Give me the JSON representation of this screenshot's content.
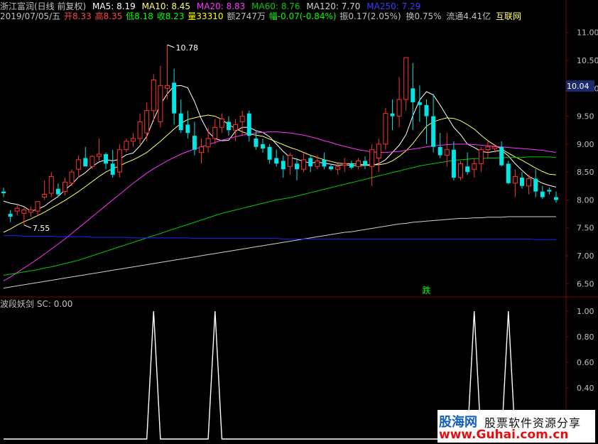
{
  "header": {
    "name": "浙江富润(日线 前复权)",
    "ma5": "MA5: 8.19",
    "ma10": "MA10: 8.45",
    "ma20": "MA20: 8.83",
    "ma60": "MA60: 8.76",
    "ma120": "MA120: 7.70",
    "ma250": "MA250: 7.29",
    "date": "2019/07/05/五",
    "open": "开8.33",
    "high": "高8.35",
    "low": "低8.18",
    "close": "收8.23",
    "volume": "量33310",
    "amount": "额2747万",
    "change": "幅-0.07(-0.84%)",
    "amplitude": "振0.17(2.05%)",
    "turnover": "换0.75%",
    "float": "流通4.41亿",
    "concept": "互联网"
  },
  "colors": {
    "up": "#ff3333",
    "down": "#00e5e5",
    "ma5": "#ffffff",
    "ma10": "#ffff66",
    "ma20": "#ff33ff",
    "ma60": "#00cc00",
    "ma120": "#d0d0d0",
    "ma250": "#2020ff",
    "grid": "#800000",
    "label_green": "#00ff00",
    "current_price_bg": "#1a2a6a"
  },
  "chart_data": [
    {
      "type": "candlestick",
      "ylim": [
        6.3,
        11.2
      ],
      "y_ticks": [
        "11.00",
        "10.50",
        "10.00",
        "9.50",
        "9.00",
        "8.50",
        "8.00",
        "7.50",
        "7.00",
        "6.50"
      ],
      "current_price": "10.04",
      "annotations": {
        "high": "10.78",
        "low": "7.55",
        "signal": "跌"
      },
      "candles": [
        [
          8.15,
          8.22,
          8.05,
          8.12
        ],
        [
          7.75,
          7.82,
          7.6,
          7.7
        ],
        [
          7.8,
          7.92,
          7.72,
          7.85
        ],
        [
          7.76,
          7.86,
          7.55,
          7.82
        ],
        [
          7.78,
          7.88,
          7.7,
          7.82
        ],
        [
          7.8,
          7.98,
          7.72,
          7.97
        ],
        [
          8.05,
          8.35,
          8.0,
          8.1
        ],
        [
          8.12,
          8.5,
          8.05,
          8.42
        ],
        [
          8.2,
          8.3,
          8.05,
          8.1
        ],
        [
          8.15,
          8.4,
          8.08,
          8.32
        ],
        [
          8.3,
          8.55,
          8.25,
          8.5
        ],
        [
          8.55,
          8.8,
          8.4,
          8.72
        ],
        [
          8.75,
          8.95,
          8.62,
          8.6
        ],
        [
          8.6,
          8.8,
          8.55,
          8.78
        ],
        [
          8.78,
          9.1,
          8.7,
          8.82
        ],
        [
          8.82,
          8.85,
          8.55,
          8.65
        ],
        [
          8.65,
          8.9,
          8.4,
          8.45
        ],
        [
          8.5,
          9.0,
          8.4,
          8.9
        ],
        [
          8.9,
          9.1,
          8.85,
          9.05
        ],
        [
          9.05,
          9.2,
          8.95,
          9.1
        ],
        [
          9.1,
          9.55,
          9.0,
          9.4
        ],
        [
          9.2,
          9.75,
          9.05,
          9.6
        ],
        [
          9.6,
          10.25,
          9.4,
          10.15
        ],
        [
          9.4,
          10.4,
          9.3,
          10.05
        ],
        [
          10.0,
          10.78,
          9.8,
          10.05
        ],
        [
          10.1,
          10.35,
          9.35,
          9.55
        ],
        [
          9.55,
          9.8,
          9.2,
          9.25
        ],
        [
          9.35,
          9.6,
          9.1,
          9.2
        ],
        [
          9.15,
          9.4,
          8.8,
          8.9
        ],
        [
          8.85,
          9.1,
          8.65,
          8.95
        ],
        [
          8.95,
          9.3,
          8.85,
          9.1
        ],
        [
          9.1,
          9.45,
          9.0,
          9.3
        ],
        [
          9.3,
          9.55,
          9.2,
          9.45
        ],
        [
          9.4,
          9.5,
          9.15,
          9.25
        ],
        [
          9.25,
          9.45,
          9.05,
          9.35
        ],
        [
          9.4,
          9.6,
          9.15,
          9.5
        ],
        [
          9.55,
          9.6,
          9.05,
          9.15
        ],
        [
          9.1,
          9.25,
          8.9,
          8.95
        ],
        [
          9.0,
          9.1,
          8.85,
          8.92
        ],
        [
          8.95,
          9.0,
          8.65,
          8.72
        ],
        [
          8.75,
          8.9,
          8.6,
          8.65
        ],
        [
          8.7,
          8.8,
          8.4,
          8.55
        ],
        [
          8.6,
          8.85,
          8.45,
          8.8
        ],
        [
          8.65,
          8.75,
          8.35,
          8.55
        ],
        [
          8.55,
          8.85,
          8.5,
          8.72
        ],
        [
          8.75,
          8.8,
          8.5,
          8.6
        ],
        [
          8.6,
          8.8,
          8.55,
          8.7
        ],
        [
          8.72,
          8.85,
          8.55,
          8.6
        ],
        [
          8.6,
          8.65,
          8.52,
          8.55
        ],
        [
          8.55,
          8.65,
          8.45,
          8.6
        ],
        [
          8.62,
          8.75,
          8.5,
          8.65
        ],
        [
          8.65,
          8.7,
          8.55,
          8.58
        ],
        [
          8.6,
          8.75,
          8.55,
          8.7
        ],
        [
          8.7,
          8.78,
          8.55,
          8.62
        ],
        [
          8.6,
          9.0,
          8.25,
          8.9
        ],
        [
          8.75,
          9.1,
          8.5,
          9.0
        ],
        [
          9.0,
          9.65,
          8.9,
          9.55
        ],
        [
          9.55,
          9.8,
          9.25,
          9.5
        ],
        [
          9.5,
          10.2,
          9.3,
          9.8
        ],
        [
          9.8,
          10.5,
          9.6,
          10.55
        ],
        [
          10.0,
          10.45,
          9.25,
          9.75
        ],
        [
          9.75,
          10.05,
          9.4,
          9.7
        ],
        [
          9.7,
          9.8,
          9.0,
          9.5
        ],
        [
          9.5,
          9.9,
          8.85,
          8.95
        ],
        [
          8.95,
          9.2,
          8.75,
          8.8
        ],
        [
          8.8,
          9.2,
          8.6,
          8.9
        ],
        [
          8.9,
          9.05,
          8.35,
          8.4
        ],
        [
          8.4,
          8.7,
          8.35,
          8.65
        ],
        [
          8.6,
          8.85,
          8.45,
          8.5
        ],
        [
          8.55,
          8.75,
          8.4,
          8.65
        ],
        [
          8.65,
          8.95,
          8.5,
          8.9
        ],
        [
          8.9,
          9.05,
          8.75,
          8.95
        ],
        [
          8.92,
          9.0,
          8.85,
          8.95
        ],
        [
          8.95,
          9.05,
          8.6,
          8.62
        ],
        [
          8.65,
          8.7,
          8.28,
          8.3
        ],
        [
          8.3,
          8.55,
          8.05,
          8.42
        ],
        [
          8.4,
          8.5,
          8.2,
          8.25
        ],
        [
          8.25,
          8.45,
          8.1,
          8.38
        ],
        [
          8.38,
          8.55,
          8.05,
          8.15
        ],
        [
          8.15,
          8.25,
          8.02,
          8.05
        ],
        [
          8.18,
          8.22,
          8.1,
          8.15
        ],
        [
          8.05,
          8.15,
          7.95,
          8.0
        ]
      ],
      "series": [
        {
          "name": "MA5",
          "values": [
            7.98,
            7.94,
            7.92,
            7.88,
            7.8,
            7.83,
            7.89,
            7.98,
            8.06,
            8.18,
            8.28,
            8.41,
            8.49,
            8.6,
            8.68,
            8.72,
            8.7,
            8.73,
            8.81,
            8.84,
            8.97,
            9.14,
            9.44,
            9.71,
            9.9,
            10.04,
            10.05,
            10.01,
            9.76,
            9.45,
            9.22,
            9.1,
            9.06,
            9.07,
            9.23,
            9.3,
            9.3,
            9.24,
            9.21,
            9.13,
            9.0,
            8.87,
            8.76,
            8.73,
            8.69,
            8.66,
            8.68,
            8.66,
            8.64,
            8.62,
            8.63,
            8.62,
            8.61,
            8.62,
            8.62,
            8.65,
            8.72,
            8.85,
            8.98,
            9.17,
            9.51,
            9.79,
            9.94,
            9.88,
            9.7,
            9.5,
            9.3,
            9.17,
            9.0,
            8.94,
            8.87,
            8.85,
            8.87,
            8.89,
            8.79,
            8.65,
            8.53,
            8.42,
            8.36,
            8.3,
            8.26,
            8.23
          ]
        },
        {
          "name": "MA10",
          "values": [
            7.42,
            7.48,
            7.55,
            7.61,
            7.66,
            7.72,
            7.78,
            7.85,
            7.92,
            7.99,
            8.07,
            8.15,
            8.24,
            8.33,
            8.42,
            8.5,
            8.56,
            8.61,
            8.67,
            8.72,
            8.78,
            8.85,
            8.95,
            9.05,
            9.16,
            9.27,
            9.37,
            9.44,
            9.47,
            9.5,
            9.52,
            9.5,
            9.44,
            9.35,
            9.28,
            9.22,
            9.18,
            9.16,
            9.14,
            9.09,
            9.04,
            8.99,
            8.94,
            8.9,
            8.85,
            8.8,
            8.76,
            8.72,
            8.69,
            8.66,
            8.65,
            8.65,
            8.64,
            8.63,
            8.63,
            8.63,
            8.65,
            8.7,
            8.78,
            8.88,
            9.01,
            9.17,
            9.32,
            9.4,
            9.44,
            9.47,
            9.46,
            9.42,
            9.35,
            9.27,
            9.16,
            9.06,
            8.98,
            8.91,
            8.84,
            8.77,
            8.71,
            8.64,
            8.57,
            8.51,
            8.46,
            8.45
          ]
        },
        {
          "name": "MA20",
          "values": [
            6.55,
            6.62,
            6.7,
            6.78,
            6.86,
            6.94,
            7.03,
            7.12,
            7.21,
            7.3,
            7.4,
            7.5,
            7.6,
            7.7,
            7.8,
            7.9,
            8.0,
            8.1,
            8.2,
            8.3,
            8.39,
            8.48,
            8.56,
            8.63,
            8.7,
            8.76,
            8.82,
            8.87,
            8.91,
            8.95,
            8.99,
            9.03,
            9.07,
            9.1,
            9.13,
            9.16,
            9.18,
            9.2,
            9.21,
            9.22,
            9.22,
            9.21,
            9.2,
            9.18,
            9.16,
            9.13,
            9.1,
            9.06,
            9.03,
            8.99,
            8.96,
            8.93,
            8.9,
            8.88,
            8.86,
            8.85,
            8.85,
            8.86,
            8.87,
            8.89,
            8.91,
            8.93,
            8.95,
            8.97,
            8.98,
            8.99,
            9.0,
            9.0,
            9.0,
            8.99,
            8.98,
            8.97,
            8.96,
            8.95,
            8.94,
            8.93,
            8.92,
            8.91,
            8.9,
            8.89,
            8.87,
            8.85
          ]
        },
        {
          "name": "MA60",
          "values": [
            6.65,
            6.67,
            6.69,
            6.71,
            6.73,
            6.75,
            6.78,
            6.8,
            6.83,
            6.86,
            6.89,
            6.92,
            6.96,
            7.0,
            7.04,
            7.08,
            7.12,
            7.16,
            7.2,
            7.24,
            7.28,
            7.32,
            7.36,
            7.4,
            7.44,
            7.48,
            7.52,
            7.56,
            7.6,
            7.64,
            7.68,
            7.72,
            7.76,
            7.79,
            7.82,
            7.85,
            7.88,
            7.91,
            7.94,
            7.97,
            8.0,
            8.02,
            8.04,
            8.07,
            8.1,
            8.13,
            8.16,
            8.19,
            8.22,
            8.25,
            8.28,
            8.31,
            8.34,
            8.37,
            8.4,
            8.43,
            8.46,
            8.49,
            8.52,
            8.55,
            8.58,
            8.61,
            8.63,
            8.65,
            8.67,
            8.69,
            8.71,
            8.72,
            8.73,
            8.74,
            8.74,
            8.75,
            8.75,
            8.76,
            8.76,
            8.76,
            8.76,
            8.77,
            8.77,
            8.77,
            8.77,
            8.76
          ]
        },
        {
          "name": "MA120",
          "values": [
            6.42,
            6.44,
            6.46,
            6.48,
            6.5,
            6.52,
            6.54,
            6.56,
            6.58,
            6.6,
            6.62,
            6.64,
            6.66,
            6.68,
            6.7,
            6.72,
            6.74,
            6.76,
            6.78,
            6.8,
            6.82,
            6.84,
            6.86,
            6.88,
            6.9,
            6.92,
            6.94,
            6.96,
            6.98,
            7.0,
            7.02,
            7.04,
            7.06,
            7.08,
            7.1,
            7.12,
            7.14,
            7.16,
            7.18,
            7.2,
            7.22,
            7.24,
            7.26,
            7.28,
            7.3,
            7.32,
            7.34,
            7.36,
            7.38,
            7.4,
            7.42,
            7.43,
            7.45,
            7.47,
            7.49,
            7.51,
            7.53,
            7.55,
            7.57,
            7.58,
            7.6,
            7.61,
            7.62,
            7.63,
            7.64,
            7.65,
            7.66,
            7.67,
            7.67,
            7.68,
            7.68,
            7.69,
            7.69,
            7.69,
            7.7,
            7.7,
            7.7,
            7.7,
            7.7,
            7.7,
            7.7,
            7.7
          ]
        },
        {
          "name": "MA250",
          "values": [
            7.36,
            7.36,
            7.36,
            7.35,
            7.35,
            7.35,
            7.35,
            7.35,
            7.34,
            7.34,
            7.34,
            7.34,
            7.34,
            7.33,
            7.33,
            7.33,
            7.33,
            7.33,
            7.33,
            7.32,
            7.32,
            7.32,
            7.32,
            7.32,
            7.32,
            7.32,
            7.32,
            7.32,
            7.31,
            7.31,
            7.31,
            7.31,
            7.31,
            7.31,
            7.31,
            7.31,
            7.31,
            7.31,
            7.31,
            7.31,
            7.31,
            7.3,
            7.3,
            7.3,
            7.3,
            7.3,
            7.3,
            7.3,
            7.3,
            7.3,
            7.3,
            7.3,
            7.3,
            7.3,
            7.3,
            7.3,
            7.3,
            7.3,
            7.3,
            7.3,
            7.3,
            7.3,
            7.3,
            7.3,
            7.3,
            7.3,
            7.3,
            7.3,
            7.3,
            7.3,
            7.3,
            7.3,
            7.3,
            7.3,
            7.3,
            7.3,
            7.3,
            7.3,
            7.29,
            7.29,
            7.29,
            7.29
          ]
        }
      ]
    },
    {
      "type": "line",
      "name": "波段妖剑",
      "label": "SC: 0.00",
      "ylim": [
        0,
        1.1
      ],
      "y_ticks": [
        "1.00",
        "0.80",
        "0.60",
        "0.40"
      ],
      "spike_indices": [
        22,
        31,
        69,
        74
      ],
      "values_note": ""
    }
  ],
  "watermark": {
    "logo": "股海网",
    "subtitle": "股票软件资源分享",
    "url": "www.Guhai.com.cn"
  }
}
